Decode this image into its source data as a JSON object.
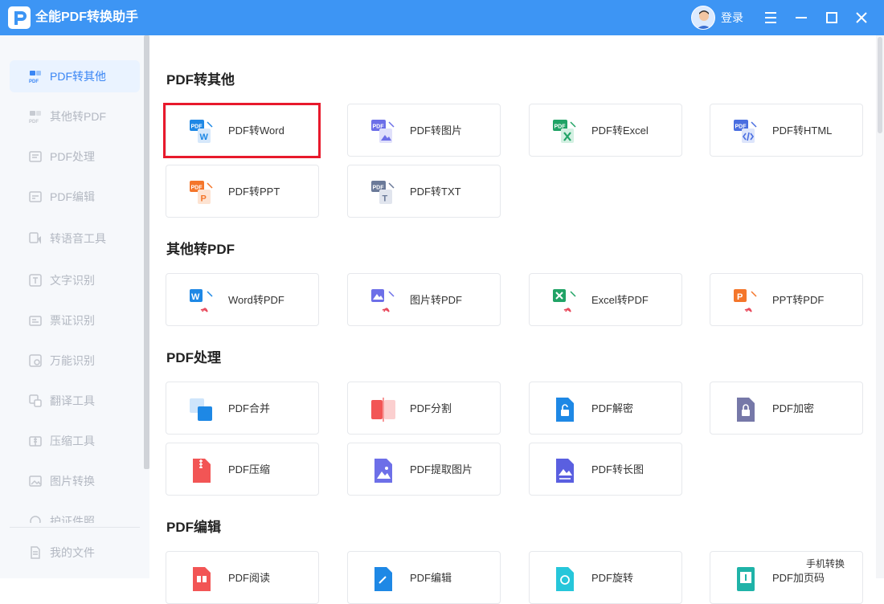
{
  "app": {
    "title": "全能PDF转换助手",
    "login": "登录"
  },
  "colors": {
    "titlebar": "#3d95f4",
    "accent": "#3a86f4",
    "highlight": "#e8192c"
  },
  "window_controls": [
    {
      "icon": "menu-icon"
    },
    {
      "icon": "minimize-icon"
    },
    {
      "icon": "maximize-icon"
    },
    {
      "icon": "close-icon"
    }
  ],
  "sidebar": {
    "items": [
      {
        "label": "PDF转其他",
        "icon": "pdf-icon",
        "active": true
      },
      {
        "label": "其他转PDF",
        "icon": "pdf-icon"
      },
      {
        "label": "PDF处理",
        "icon": "document-icon"
      },
      {
        "label": "PDF编辑",
        "icon": "document-icon"
      },
      {
        "label": "转语音工具",
        "icon": "audio-icon"
      },
      {
        "label": "文字识别",
        "icon": "text-ocr-icon"
      },
      {
        "label": "票证识别",
        "icon": "ticket-icon"
      },
      {
        "label": "万能识别",
        "icon": "scan-icon"
      },
      {
        "label": "翻译工具",
        "icon": "translate-icon"
      },
      {
        "label": "压缩工具",
        "icon": "compress-icon"
      },
      {
        "label": "图片转换",
        "icon": "image-icon"
      },
      {
        "label": "护证件照",
        "icon": "id-photo-icon"
      }
    ],
    "my_files": "我的文件"
  },
  "sections": [
    {
      "title": "PDF转其他",
      "items": [
        {
          "label": "PDF转Word",
          "icon": "pdf-to-word-icon"
        },
        {
          "label": "PDF转图片",
          "icon": "pdf-to-image-icon"
        },
        {
          "label": "PDF转Excel",
          "icon": "pdf-to-excel-icon"
        },
        {
          "label": "PDF转HTML",
          "icon": "pdf-to-html-icon"
        },
        {
          "label": "PDF转PPT",
          "icon": "pdf-to-ppt-icon"
        },
        {
          "label": "PDF转TXT",
          "icon": "pdf-to-txt-icon"
        }
      ]
    },
    {
      "title": "其他转PDF",
      "items": [
        {
          "label": "Word转PDF",
          "icon": "word-to-pdf-icon"
        },
        {
          "label": "图片转PDF",
          "icon": "image-to-pdf-icon"
        },
        {
          "label": "Excel转PDF",
          "icon": "excel-to-pdf-icon"
        },
        {
          "label": "PPT转PDF",
          "icon": "ppt-to-pdf-icon"
        }
      ]
    },
    {
      "title": "PDF处理",
      "items": [
        {
          "label": "PDF合并",
          "icon": "pdf-merge-icon"
        },
        {
          "label": "PDF分割",
          "icon": "pdf-split-icon"
        },
        {
          "label": "PDF解密",
          "icon": "pdf-decrypt-icon"
        },
        {
          "label": "PDF加密",
          "icon": "pdf-encrypt-icon"
        },
        {
          "label": "PDF压缩",
          "icon": "pdf-compress-icon"
        },
        {
          "label": "PDF提取图片",
          "icon": "pdf-extract-image-icon"
        },
        {
          "label": "PDF转长图",
          "icon": "pdf-long-image-icon"
        }
      ]
    },
    {
      "title": "PDF编辑",
      "items": [
        {
          "label": "PDF阅读",
          "icon": "pdf-read-icon"
        },
        {
          "label": "PDF编辑",
          "icon": "pdf-edit-icon"
        },
        {
          "label": "PDF旋转",
          "icon": "pdf-rotate-icon"
        },
        {
          "label": "PDF加页码",
          "icon": "pdf-page-number-icon"
        }
      ]
    }
  ],
  "floating": {
    "mobile_convert": "手机转换"
  }
}
